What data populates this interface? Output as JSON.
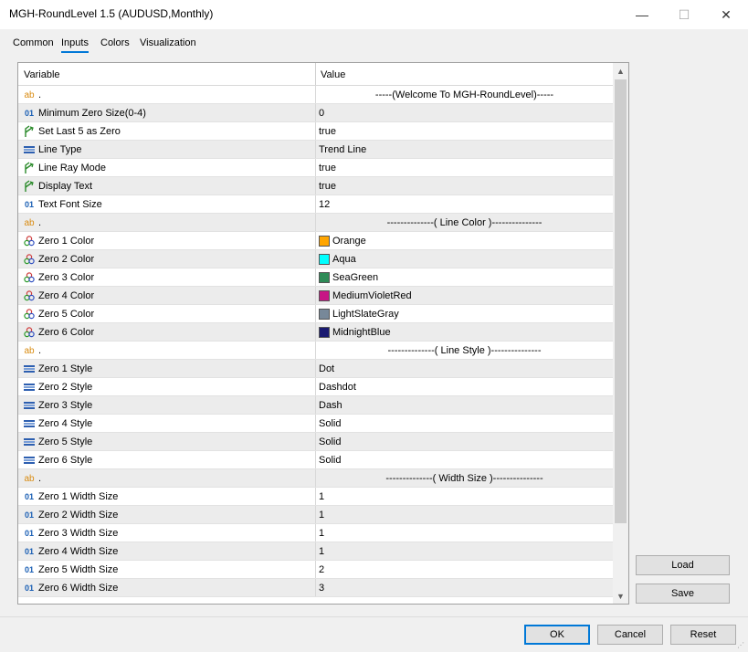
{
  "window": {
    "title": "MGH-RoundLevel 1.5 (AUDUSD,Monthly)",
    "minimize": "—",
    "maximize": "☐",
    "close": "✕"
  },
  "tabs": [
    {
      "label": "Common",
      "active": false
    },
    {
      "label": "Inputs",
      "active": true
    },
    {
      "label": "Colors",
      "active": false
    },
    {
      "label": "Visualization",
      "active": false
    }
  ],
  "grid": {
    "col_variable": "Variable",
    "col_value": "Value",
    "rows": [
      {
        "icon": "ab",
        "variable": ".",
        "value": "-----(Welcome To MGH-RoundLevel)-----",
        "center": true
      },
      {
        "icon": "01",
        "variable": "Minimum Zero Size(0-4)",
        "value": "0"
      },
      {
        "icon": "bool",
        "variable": "Set Last 5 as Zero",
        "value": "true"
      },
      {
        "icon": "enum",
        "variable": "Line Type",
        "value": "Trend Line"
      },
      {
        "icon": "bool",
        "variable": "Line Ray Mode",
        "value": "true"
      },
      {
        "icon": "bool",
        "variable": "Display Text",
        "value": "true"
      },
      {
        "icon": "01",
        "variable": "Text Font Size",
        "value": "12"
      },
      {
        "icon": "ab",
        "variable": ".",
        "value": "--------------( Line Color )---------------",
        "center": true
      },
      {
        "icon": "color",
        "variable": "Zero 1 Color",
        "value": "Orange",
        "swatch": "#ffa500"
      },
      {
        "icon": "color",
        "variable": "Zero 2 Color",
        "value": "Aqua",
        "swatch": "#00ffff"
      },
      {
        "icon": "color",
        "variable": "Zero 3 Color",
        "value": "SeaGreen",
        "swatch": "#2e8b57"
      },
      {
        "icon": "color",
        "variable": "Zero 4 Color",
        "value": "MediumVioletRed",
        "swatch": "#c71585"
      },
      {
        "icon": "color",
        "variable": "Zero 5 Color",
        "value": "LightSlateGray",
        "swatch": "#778899"
      },
      {
        "icon": "color",
        "variable": "Zero 6 Color",
        "value": "MidnightBlue",
        "swatch": "#191970"
      },
      {
        "icon": "ab",
        "variable": ".",
        "value": "--------------( Line Style )---------------",
        "center": true
      },
      {
        "icon": "enum",
        "variable": "Zero 1 Style",
        "value": "Dot"
      },
      {
        "icon": "enum",
        "variable": "Zero 2 Style",
        "value": "Dashdot"
      },
      {
        "icon": "enum",
        "variable": "Zero 3 Style",
        "value": "Dash"
      },
      {
        "icon": "enum",
        "variable": "Zero 4 Style",
        "value": "Solid"
      },
      {
        "icon": "enum",
        "variable": "Zero 5 Style",
        "value": "Solid"
      },
      {
        "icon": "enum",
        "variable": "Zero 6 Style",
        "value": "Solid"
      },
      {
        "icon": "ab",
        "variable": ".",
        "value": "--------------( Width Size )---------------",
        "center": true
      },
      {
        "icon": "01",
        "variable": "Zero 1 Width Size",
        "value": "1"
      },
      {
        "icon": "01",
        "variable": "Zero 2 Width Size",
        "value": "1"
      },
      {
        "icon": "01",
        "variable": "Zero 3 Width Size",
        "value": "1"
      },
      {
        "icon": "01",
        "variable": "Zero 4 Width Size",
        "value": "1"
      },
      {
        "icon": "01",
        "variable": "Zero 5 Width Size",
        "value": "2"
      },
      {
        "icon": "01",
        "variable": "Zero 6 Width Size",
        "value": "3"
      }
    ]
  },
  "side_buttons": {
    "load": "Load",
    "save": "Save"
  },
  "footer_buttons": {
    "ok": "OK",
    "cancel": "Cancel",
    "reset": "Reset"
  },
  "colors": {
    "accent": "#0078d7",
    "alt_row": "#ececec"
  }
}
